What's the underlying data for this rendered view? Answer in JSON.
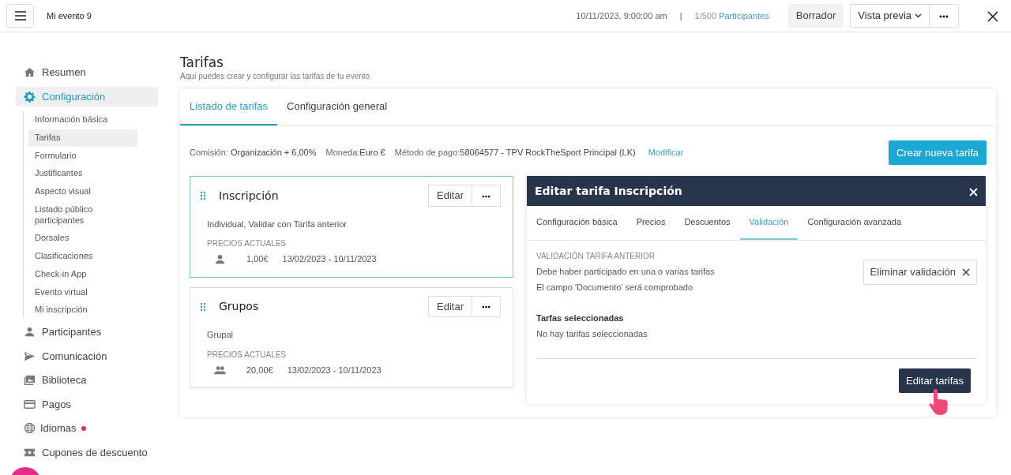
{
  "header": {
    "title": "Mi evento 9",
    "date": "10/11/2023, 9:00:00 am",
    "separator": "|",
    "participants_count": "1",
    "participants_total": "/500",
    "participants_label": "Participantes",
    "status": "Borrador",
    "preview_button": "Vista previa"
  },
  "sidebar": {
    "items": [
      {
        "label": "Resumen",
        "selected": false,
        "notification": false
      },
      {
        "label": "Configuración",
        "selected": true,
        "notification": false,
        "children": [
          {
            "label": "Información básica",
            "selected": false
          },
          {
            "label": "Tarifas",
            "selected": true
          },
          {
            "label": "Formulario",
            "selected": false
          },
          {
            "label": "Justificantes",
            "selected": false
          },
          {
            "label": "Aspecto visual",
            "selected": false
          },
          {
            "label": "Listado público participantes",
            "selected": false
          },
          {
            "label": "Dorsales",
            "selected": false
          },
          {
            "label": "Clasificaciones",
            "selected": false
          },
          {
            "label": "Check-in App",
            "selected": false
          },
          {
            "label": "Evento virtual",
            "selected": false
          },
          {
            "label": "Mi inscripción",
            "selected": false
          }
        ]
      },
      {
        "label": "Participantes",
        "selected": false,
        "notification": false
      },
      {
        "label": "Comunicación",
        "selected": false,
        "notification": false
      },
      {
        "label": "Biblioteca",
        "selected": false,
        "notification": false
      },
      {
        "label": "Pagos",
        "selected": false,
        "notification": false
      },
      {
        "label": "Idiomas",
        "selected": false,
        "notification": true
      },
      {
        "label": "Cupones de descuento",
        "selected": false,
        "notification": false
      }
    ]
  },
  "page": {
    "title": "Tarifas",
    "subtitle": "Aquí puedes crear y configurar las tarifas de tu evento"
  },
  "tabs": [
    {
      "label": "Listado de tarifas",
      "selected": true
    },
    {
      "label": "Configuración general",
      "selected": false
    }
  ],
  "info": {
    "commission_label": "Comisión:",
    "commission_value": "Organización + 6,00%",
    "currency_label": "Moneda:",
    "currency_value": "Euro €",
    "payment_label": "Método de pago:",
    "payment_value": "58064577 - TPV RockTheSport Principal (LK)",
    "modify_link": "Modificar"
  },
  "create_button": "Crear nueva tarifa",
  "rates": [
    {
      "name": "Inscripción",
      "selected": true,
      "edit_button": "Editar",
      "description": "Individual, Validar con Tarifa anterior",
      "prices_heading": "PRECIOS ACTUALES",
      "prices": [
        {
          "kind": "person",
          "amount": "1,00€",
          "dates": "13/02/2023 - 10/11/2023"
        }
      ]
    },
    {
      "name": "Grupos",
      "selected": false,
      "edit_button": "Editar",
      "description": "Grupal",
      "prices_heading": "PRECIOS ACTUALES",
      "prices": [
        {
          "kind": "group",
          "amount": "20,00€",
          "dates": "13/02/2023 - 10/11/2023"
        }
      ]
    }
  ],
  "editor": {
    "title": "Editar tarifa Inscripción",
    "tabs": [
      {
        "label": "Configuración básica",
        "selected": false
      },
      {
        "label": "Precios",
        "selected": false
      },
      {
        "label": "Descuentos",
        "selected": false
      },
      {
        "label": "Validación",
        "selected": true
      },
      {
        "label": "Configuración avanzada",
        "selected": false
      }
    ],
    "section_heading": "VALIDACIÓN TARIFA ANTERIOR",
    "lines": [
      "Debe haber participado en una o varias tarifas",
      "El campo 'Documento' será comprobado"
    ],
    "remove_button": "Eliminar validación",
    "selected_heading": "Tarfas seleccionadas",
    "selected_empty": "No hay tarifas seleccionadas",
    "edit_button": "Editar tarifas"
  }
}
